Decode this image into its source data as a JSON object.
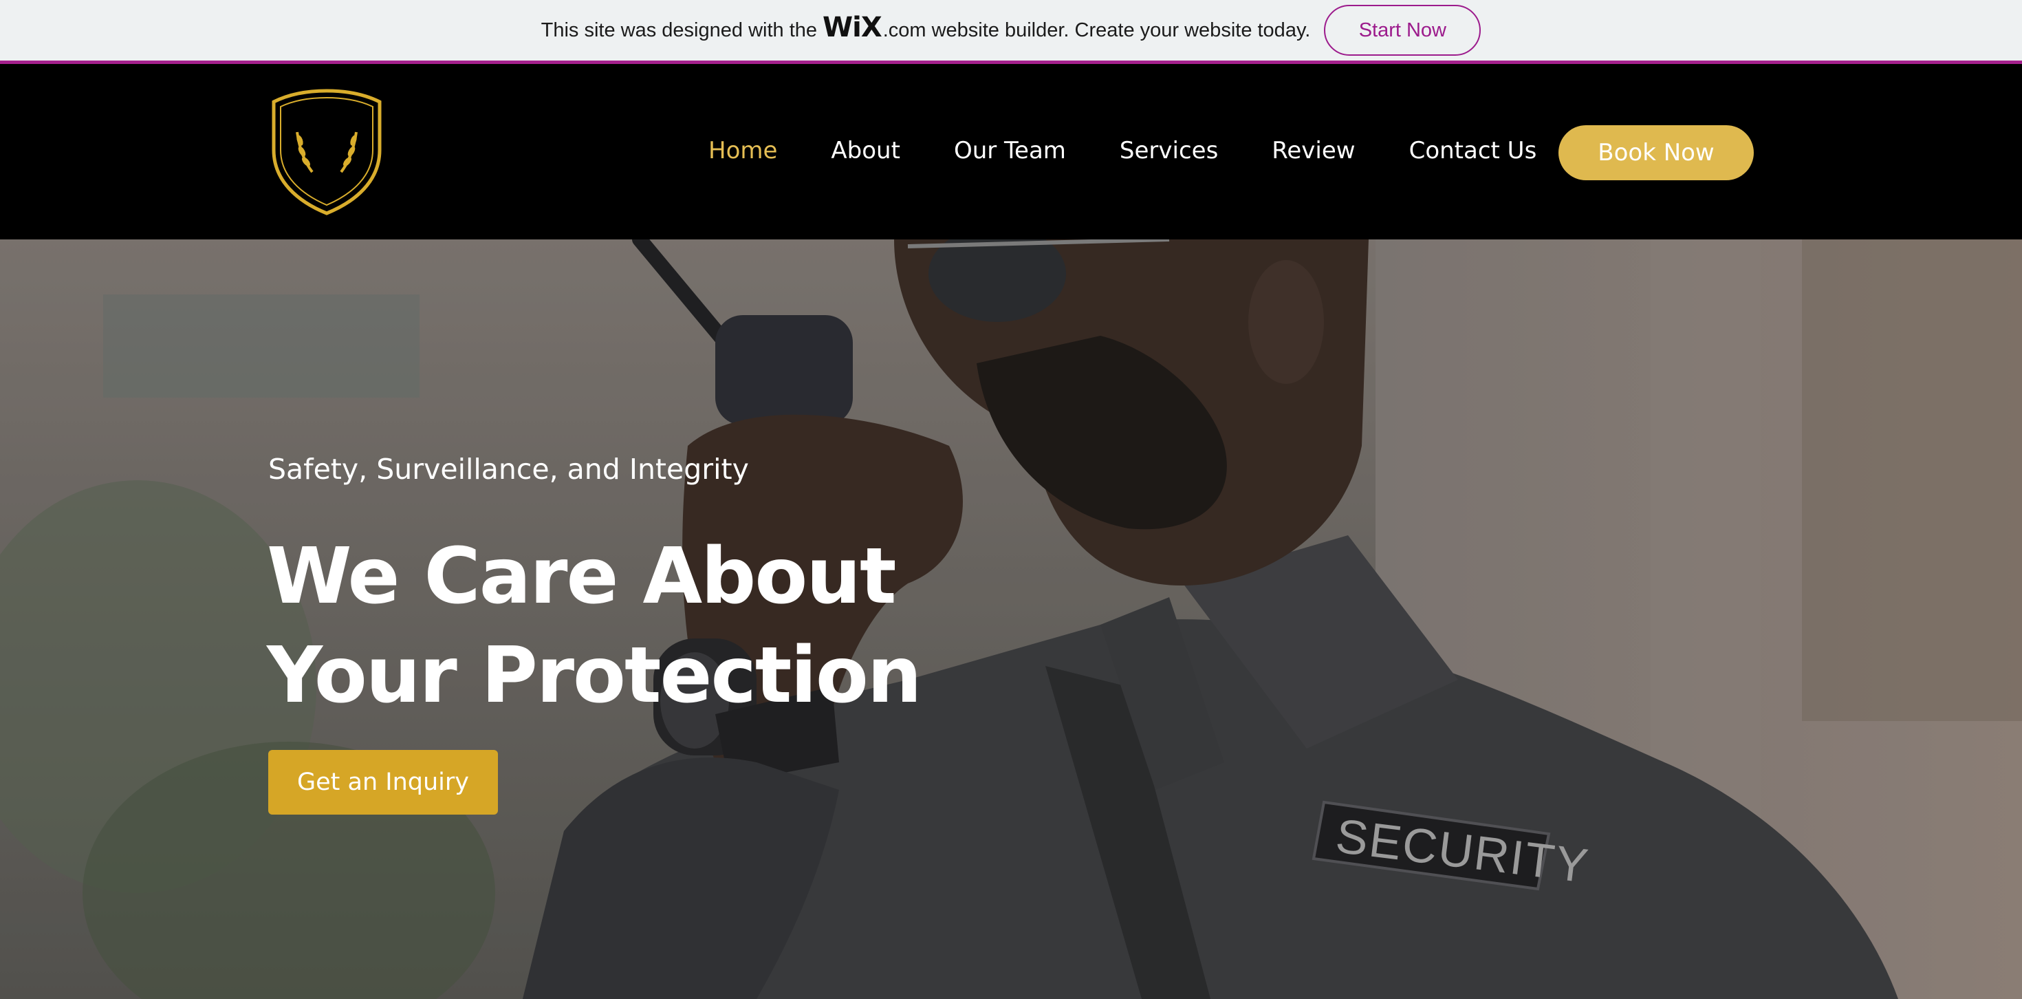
{
  "wix_banner": {
    "prefix": "This site was designed with the",
    "logo": "WiX",
    "suffix": ".com website builder. Create your website today.",
    "cta": "Start Now",
    "accent_color": "#a5218d"
  },
  "header": {
    "logo_icon": "security-badge-logo",
    "nav": [
      {
        "label": "Home",
        "active": true
      },
      {
        "label": "About",
        "active": false
      },
      {
        "label": "Our Team",
        "active": false
      },
      {
        "label": "Services",
        "active": false
      },
      {
        "label": "Review",
        "active": false
      },
      {
        "label": "Contact Us",
        "active": false
      }
    ],
    "cta": "Book Now",
    "accent_color": "#dfb94f"
  },
  "hero": {
    "tagline": "Safety, Surveillance, and Integrity",
    "headline": "We Care About Your Protection",
    "cta": "Get an Inquiry",
    "cta_color": "#d6a626",
    "background": "security-guard-photo"
  }
}
